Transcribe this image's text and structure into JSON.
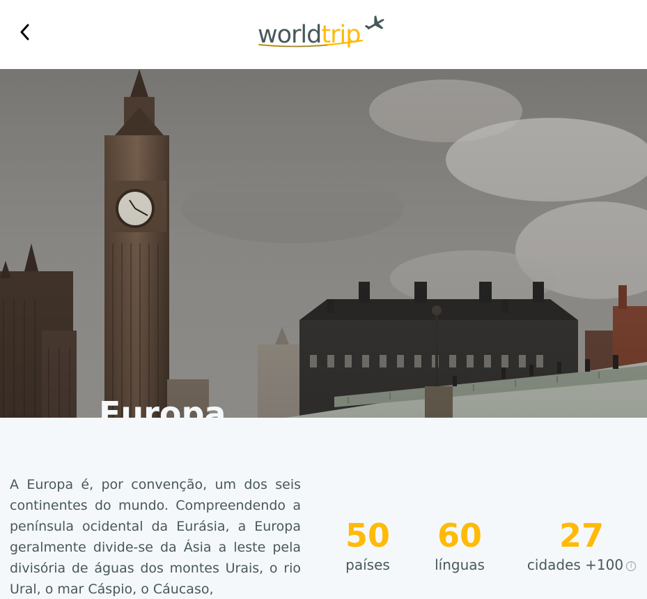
{
  "header": {
    "back_icon": "chevron-left-icon",
    "logo": {
      "part1": "world",
      "part2": "trip",
      "icon": "airplane-icon"
    }
  },
  "hero": {
    "title": "Europa"
  },
  "content": {
    "description": "A Europa é, por convenção, um dos seis continentes do mundo. Compreendendo a península ocidental da Eurásia, a Europa geralmente divide-se da Ásia a leste pela divisória de águas dos montes Urais, o rio Ural, o mar Cáspio, o Cáucaso,",
    "stats": [
      {
        "value": "50",
        "label": "países"
      },
      {
        "value": "60",
        "label": "línguas"
      },
      {
        "value": "27",
        "label": "cidades +100",
        "info_icon": "info-icon"
      }
    ]
  },
  "colors": {
    "accent": "#FFBA08",
    "text": "#47585B",
    "background": "#F5F8FA",
    "header_bg": "#FFFFFF",
    "hero_text": "#F5F8FA"
  }
}
